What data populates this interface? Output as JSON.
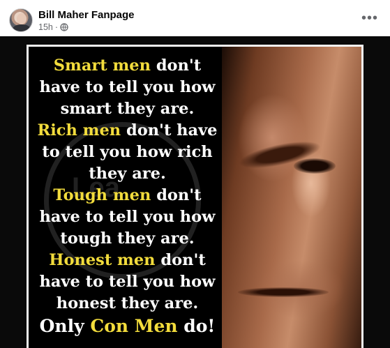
{
  "post": {
    "page_name": "Bill Maher Fanpage",
    "time": "15h",
    "separator": "·",
    "privacy_icon": "globe-icon",
    "more_icon": "more-options-icon",
    "more_glyph": "•••"
  },
  "image": {
    "watermark_text": "Lea",
    "lines": [
      {
        "hl": "Smart men",
        "rest": " don't"
      },
      {
        "hl": "",
        "rest": "have to tell you how"
      },
      {
        "hl": "",
        "rest": "smart they are."
      },
      {
        "hl": "Rich men",
        "rest": " don't have"
      },
      {
        "hl": "",
        "rest": "to tell you how rich"
      },
      {
        "hl": "",
        "rest": "they are."
      },
      {
        "hl": "Tough men",
        "rest": " don't"
      },
      {
        "hl": "",
        "rest": "have to tell you how"
      },
      {
        "hl": "",
        "rest": "tough they are."
      },
      {
        "hl": "Honest men",
        "rest": " don't"
      },
      {
        "hl": "",
        "rest": "have to tell you how"
      },
      {
        "hl": "",
        "rest": "honest they are."
      }
    ],
    "closer": {
      "before": "Only ",
      "hl": "Con Men",
      "after": " do!"
    },
    "colors": {
      "highlight": "#f2dc3c",
      "text": "#ffffff",
      "background": "#000000"
    }
  }
}
